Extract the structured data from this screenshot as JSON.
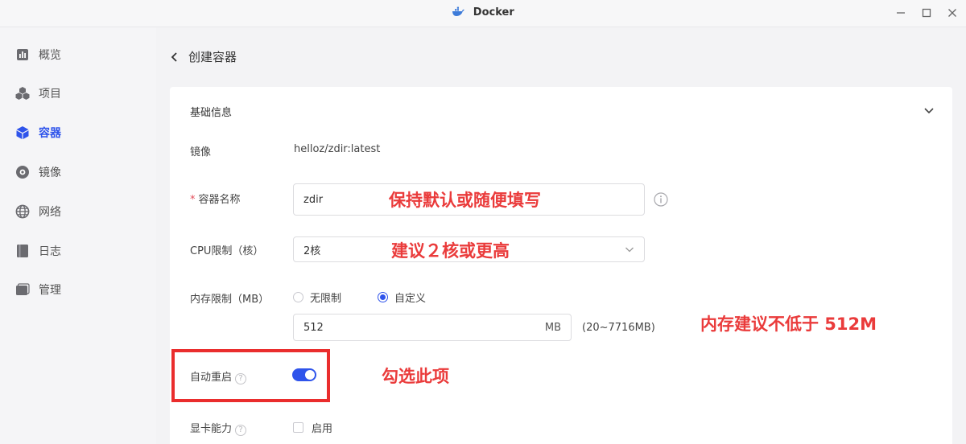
{
  "window": {
    "title": "Docker",
    "minimize": "—",
    "maximize": "☐",
    "close": "✕"
  },
  "sidebar": {
    "items": [
      {
        "label": "概览",
        "icon": "chart-icon",
        "active": false
      },
      {
        "label": "项目",
        "icon": "cubes-icon",
        "active": false
      },
      {
        "label": "容器",
        "icon": "container-icon",
        "active": true
      },
      {
        "label": "镜像",
        "icon": "disc-icon",
        "active": false
      },
      {
        "label": "网络",
        "icon": "globe-icon",
        "active": false
      },
      {
        "label": "日志",
        "icon": "log-icon",
        "active": false
      },
      {
        "label": "管理",
        "icon": "manage-icon",
        "active": false
      }
    ],
    "accent": "#2f54eb"
  },
  "page": {
    "title": "创建容器"
  },
  "form": {
    "section_title": "基础信息",
    "image": {
      "label": "镜像",
      "value": "helloz/zdir:latest"
    },
    "name": {
      "required_mark": "*",
      "label": "容器名称",
      "value": "zdir"
    },
    "cpu": {
      "label": "CPU限制（核）",
      "value": "2核"
    },
    "memory": {
      "label": "内存限制（MB）",
      "options": [
        "无限制",
        "自定义"
      ],
      "selected": "自定义",
      "value": "512",
      "unit": "MB",
      "range": "(20~7716MB)"
    },
    "auto_restart": {
      "label": "自动重启",
      "enabled": true
    },
    "gpu": {
      "label": "显卡能力",
      "option": "启用",
      "checked": false
    }
  },
  "annotations": {
    "name_hint": "保持默认或随便填写",
    "cpu_hint": "建议２核或更高",
    "memory_hint": "内存建议不低于 512M",
    "restart_hint": "勾选此项",
    "color": "#ea3b3b"
  }
}
